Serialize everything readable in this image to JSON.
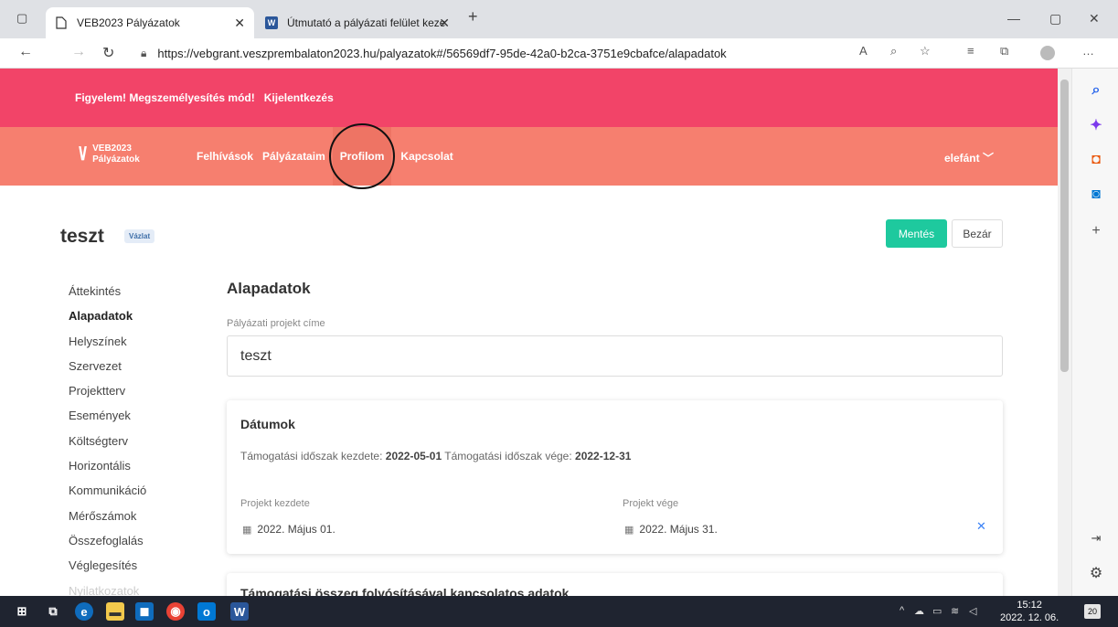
{
  "browser": {
    "tabs": [
      {
        "title": "VEB2023 Pályázatok",
        "icon": "document-icon",
        "active": true
      },
      {
        "title": "Útmutató a pályázati felület keze",
        "icon": "word-icon",
        "active": false
      }
    ],
    "url": "https://vebgrant.veszprembalaton2023.hu/palyazatok#/56569df7-95de-42a0-b2ca-3751e9cbafce/alapadatok"
  },
  "impersonation": {
    "warning": "Figyelem! Megszemélyesítés mód!",
    "logout": "Kijelentkezés"
  },
  "nav": {
    "logo_line1": "VEB2023",
    "logo_line2": "Pályázatok",
    "links": [
      "Felhívások",
      "Pályázataim",
      "Profilom",
      "Kapcsolat"
    ],
    "user": "elefánt"
  },
  "project": {
    "title": "teszt",
    "status": "Vázlat",
    "save": "Mentés",
    "close": "Bezár"
  },
  "sidebar": {
    "items": [
      "Áttekintés",
      "Alapadatok",
      "Helyszínek",
      "Szervezet",
      "Projektterv",
      "Események",
      "Költségterv",
      "Horizontális",
      "Kommunikáció",
      "Mérőszámok",
      "Összefoglalás",
      "Véglegesítés",
      "Nyilatkozatok"
    ],
    "active": "Alapadatok"
  },
  "main": {
    "section_title": "Alapadatok",
    "field_label": "Pályázati projekt címe",
    "field_value": "teszt",
    "dates": {
      "title": "Dátumok",
      "period_start_label": "Támogatási időszak kezdete:",
      "period_start": "2022-05-01",
      "period_end_label": "Támogatási időszak vége:",
      "period_end": "2022-12-31",
      "start_label": "Projekt kezdete",
      "start_value": "2022. Május 01.",
      "end_label": "Projekt vége",
      "end_value": "2022. Május 31."
    },
    "next_card_title": "Támogatási összeg folyósításával kapcsolatos adatok"
  },
  "taskbar": {
    "time": "15:12",
    "date": "2022. 12. 06.",
    "notifications": "20"
  }
}
